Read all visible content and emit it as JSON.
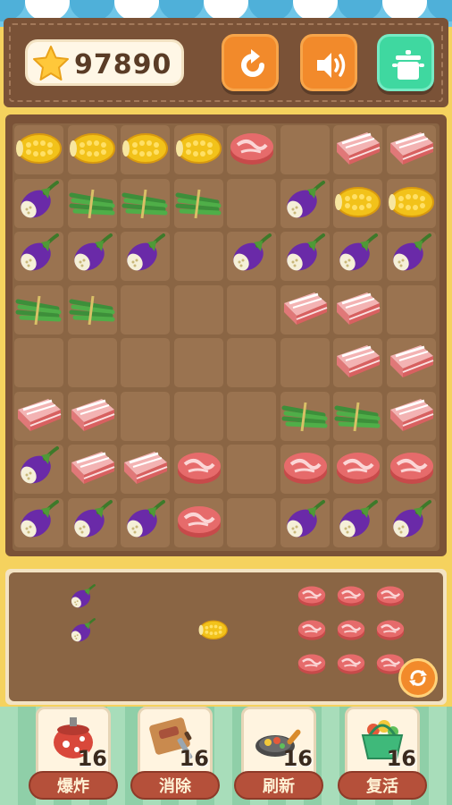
{
  "header": {
    "score": "97890",
    "buttons": {
      "refresh": "refresh-icon",
      "sound": "sound-icon",
      "pot": "pot-icon"
    }
  },
  "board": {
    "rows": 8,
    "cols": 8,
    "grid": [
      [
        "corn",
        "corn",
        "corn",
        "corn",
        "steak",
        "",
        "bacon",
        "bacon"
      ],
      [
        "eggplant",
        "greens",
        "greens",
        "greens",
        "",
        "eggplant",
        "corn",
        "corn"
      ],
      [
        "eggplant",
        "eggplant",
        "eggplant",
        "",
        "eggplant",
        "eggplant",
        "eggplant",
        "eggplant"
      ],
      [
        "greens",
        "greens",
        "",
        "",
        "",
        "bacon",
        "bacon",
        ""
      ],
      [
        "",
        "",
        "",
        "",
        "",
        "",
        "bacon",
        "bacon"
      ],
      [
        "bacon",
        "bacon",
        "",
        "",
        "",
        "greens",
        "greens",
        "bacon"
      ],
      [
        "eggplant",
        "bacon",
        "bacon",
        "steak",
        "",
        "steak",
        "steak",
        "steak"
      ],
      [
        "eggplant",
        "eggplant",
        "eggplant",
        "steak",
        "",
        "eggplant",
        "eggplant",
        "eggplant"
      ]
    ]
  },
  "tray": {
    "items": [
      {
        "type": "eggplant"
      },
      {
        "type": "eggplant"
      },
      {
        "type": "corn"
      },
      {
        "type": "steak"
      },
      {
        "type": "steak"
      },
      {
        "type": "steak"
      },
      {
        "type": "steak"
      },
      {
        "type": "steak"
      },
      {
        "type": "steak"
      },
      {
        "type": "steak"
      },
      {
        "type": "steak"
      },
      {
        "type": "steak"
      }
    ],
    "rotate_icon": "rotate-icon"
  },
  "tools": [
    {
      "label": "爆炸",
      "count": "16",
      "icon": "bomb-pot-icon"
    },
    {
      "label": "消除",
      "count": "16",
      "icon": "chopping-board-icon"
    },
    {
      "label": "刷新",
      "count": "16",
      "icon": "frying-pan-icon"
    },
    {
      "label": "复活",
      "count": "16",
      "icon": "basket-icon"
    }
  ],
  "colors": {
    "wood": "#7a5237",
    "board": "#8a6544",
    "cell": "#9a7350",
    "orange_button": "#f28a2b",
    "green_button": "#3fd8a0",
    "tool_label": "#b5503a"
  }
}
